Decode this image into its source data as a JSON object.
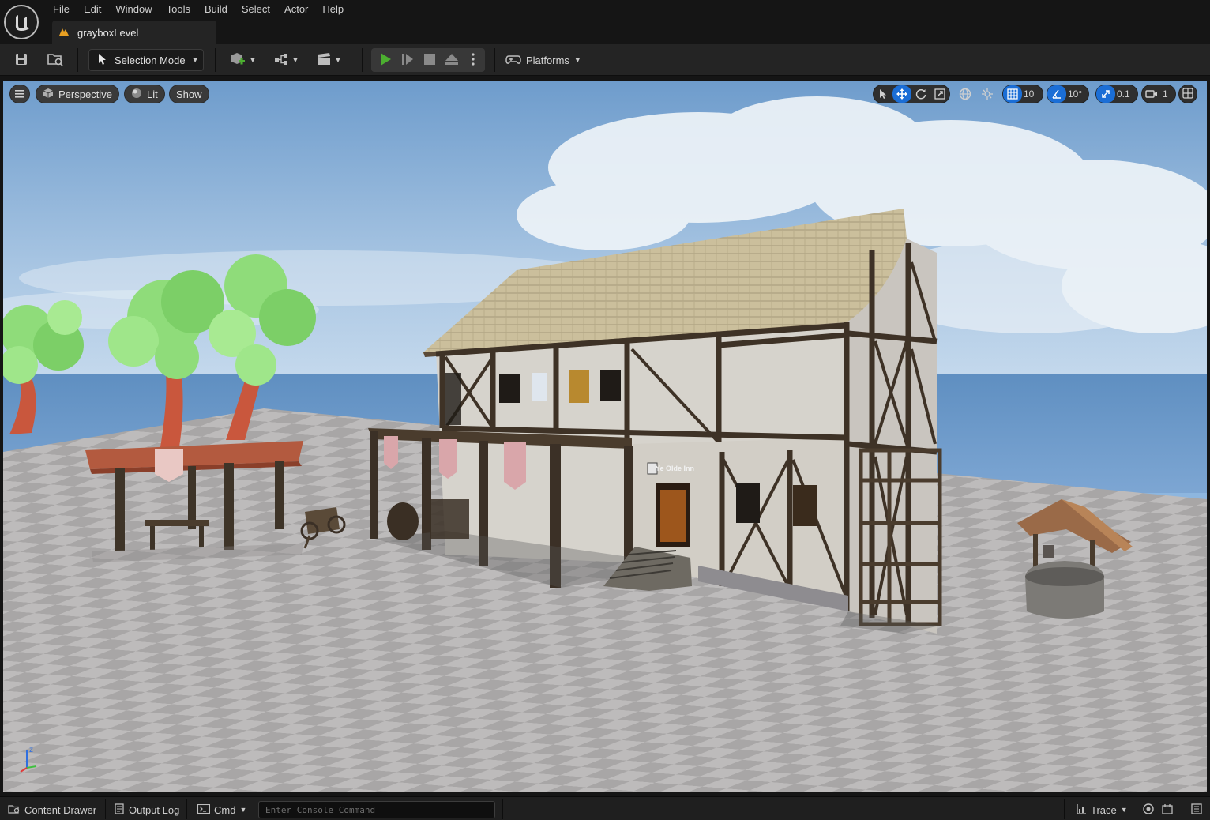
{
  "menu": {
    "items": [
      "File",
      "Edit",
      "Window",
      "Tools",
      "Build",
      "Select",
      "Actor",
      "Help"
    ]
  },
  "level_tab": {
    "label": "grayboxLevel"
  },
  "toolbar": {
    "mode_label": "Selection Mode",
    "platforms_label": "Platforms"
  },
  "viewport": {
    "perspective_label": "Perspective",
    "lit_label": "Lit",
    "show_label": "Show",
    "grid_snap_value": "10",
    "rotation_snap_value": "10°",
    "scale_snap_value": "0.1",
    "camera_speed_value": "1",
    "sign_text": "Ye Olde Inn",
    "axis_z_label": "z"
  },
  "bottom": {
    "content_drawer_label": "Content Drawer",
    "output_log_label": "Output Log",
    "cmd_label": "Cmd",
    "console_placeholder": "Enter Console Command",
    "trace_label": "Trace"
  },
  "colors": {
    "accent": "#1b6ed6",
    "play_green": "#4caf30",
    "tab_orange": "#e8a022"
  }
}
